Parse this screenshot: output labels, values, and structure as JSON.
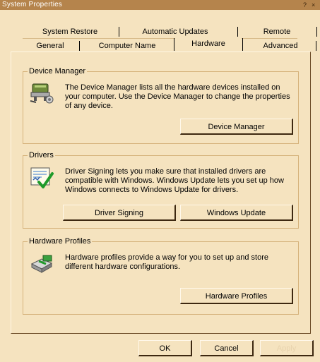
{
  "window": {
    "title": "System Properties",
    "help_glyph": "?",
    "close_glyph": "×"
  },
  "tabs": {
    "row1": [
      "System Restore",
      "Automatic Updates",
      "Remote"
    ],
    "row2": [
      "General",
      "Computer Name",
      "Hardware",
      "Advanced"
    ],
    "selected": "Hardware"
  },
  "device_manager": {
    "legend": "Device Manager",
    "icon": "device-manager-icon",
    "description": "The Device Manager lists all the hardware devices installed on your computer. Use the Device Manager to change the properties of any device.",
    "button": "Device Manager"
  },
  "drivers": {
    "legend": "Drivers",
    "icon": "driver-signing-icon",
    "description": "Driver Signing lets you make sure that installed drivers are compatible with Windows. Windows Update lets you set up how Windows connects to Windows Update for drivers.",
    "button_signing": "Driver Signing",
    "button_update": "Windows Update"
  },
  "hardware_profiles": {
    "legend": "Hardware Profiles",
    "icon": "hardware-profiles-icon",
    "description": "Hardware profiles provide a way for you to set up and store different hardware configurations.",
    "button": "Hardware Profiles"
  },
  "footer": {
    "ok": "OK",
    "cancel": "Cancel",
    "apply": "Apply",
    "apply_enabled": false
  }
}
